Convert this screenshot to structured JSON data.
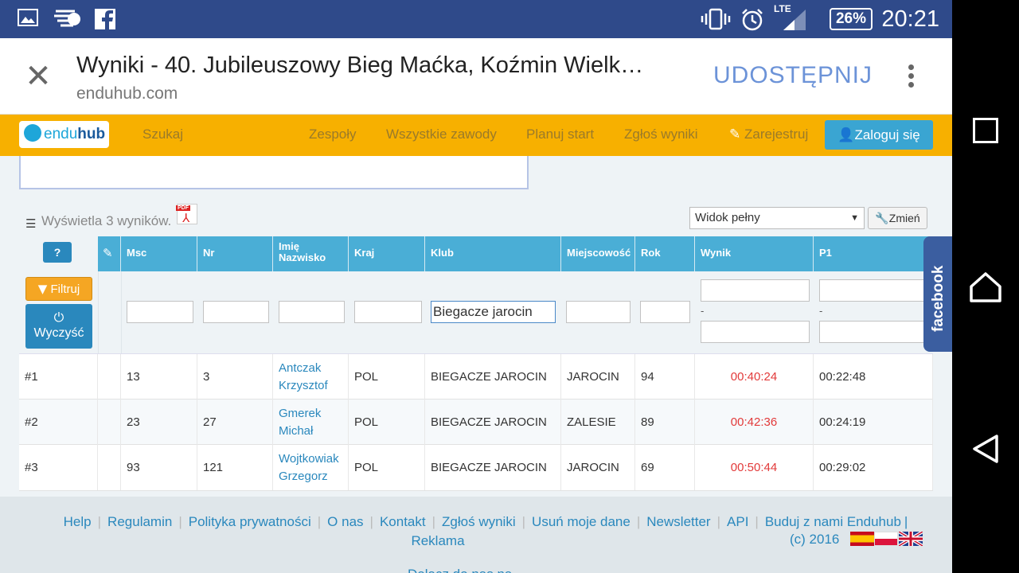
{
  "status_bar": {
    "time": "20:21",
    "battery": "26%",
    "network": "LTE",
    "icons_left": [
      "gallery-icon",
      "messenger-icon",
      "facebook-icon"
    ],
    "icons_right": [
      "vibrate-icon",
      "alarm-icon",
      "signal-icon",
      "battery-icon"
    ]
  },
  "browser": {
    "page_title": "Wyniki - 40. Jubileuszowy Bieg Maćka, Koźmin Wielk…",
    "domain": "enduhub.com",
    "share_label": "UDOSTĘPNIJ"
  },
  "nav": {
    "logo_a": "endu",
    "logo_b": "hub",
    "search": "Szukaj",
    "teams": "Zespoły",
    "all_events": "Wszystkie zawody",
    "plan_start": "Planuj start",
    "report_results": "Zgłoś wyniki",
    "register": "Zarejestruj",
    "login": "Zaloguj się"
  },
  "results": {
    "count_text": "Wyświetla 3 wyników.",
    "pdf_label": "PDF",
    "view_select": "Widok pełny",
    "change_button": "Zmień",
    "help": "?",
    "filter_button": "Filtruj",
    "clear_button": "Wyczyść",
    "columns": {
      "msc": "Msc",
      "nr": "Nr",
      "name_1": "Imię",
      "name_2": "Nazwisko",
      "kraj": "Kraj",
      "klub": "Klub",
      "miejscowosc": "Miejscowość",
      "rok": "Rok",
      "wynik": "Wynik",
      "p1": "P1"
    },
    "filters": {
      "klub_value": "Biegacze jarocin",
      "range_sep": "-"
    },
    "rows": [
      {
        "place": "#1",
        "msc": "13",
        "nr": "3",
        "first": "Antczak",
        "last": "Krzysztof",
        "kraj": "POL",
        "klub": "BIEGACZE JAROCIN",
        "miejscowosc": "JAROCIN",
        "rok": "94",
        "wynik": "00:40:24",
        "p1": "00:22:48"
      },
      {
        "place": "#2",
        "msc": "23",
        "nr": "27",
        "first": "Gmerek",
        "last": "Michał",
        "kraj": "POL",
        "klub": "BIEGACZE JAROCIN",
        "miejscowosc": "ZALESIE",
        "rok": "89",
        "wynik": "00:42:36",
        "p1": "00:24:19"
      },
      {
        "place": "#3",
        "msc": "93",
        "nr": "121",
        "first": "Wojtkowiak",
        "last": "Grzegorz",
        "kraj": "POL",
        "klub": "BIEGACZE JAROCIN",
        "miejscowosc": "JAROCIN",
        "rok": "69",
        "wynik": "00:50:44",
        "p1": "00:29:02"
      }
    ]
  },
  "facebook_tab": "facebook",
  "footer": {
    "links": [
      "Help",
      "Regulamin",
      "Polityka prywatności",
      "O nas",
      "Kontakt",
      "Zgłoś wyniki",
      "Usuń moje dane",
      "Newsletter",
      "API",
      "Buduj z nami Enduhub"
    ],
    "reklama": "Reklama",
    "copyright": "(c) 2016",
    "cut_text": "Dołącz do nas na"
  },
  "colors": {
    "status_bar": "#2f4a8a",
    "nav_bar": "#f7b000",
    "table_header": "#4aaed6",
    "link": "#2a88bd",
    "result": "#e23a3a"
  }
}
